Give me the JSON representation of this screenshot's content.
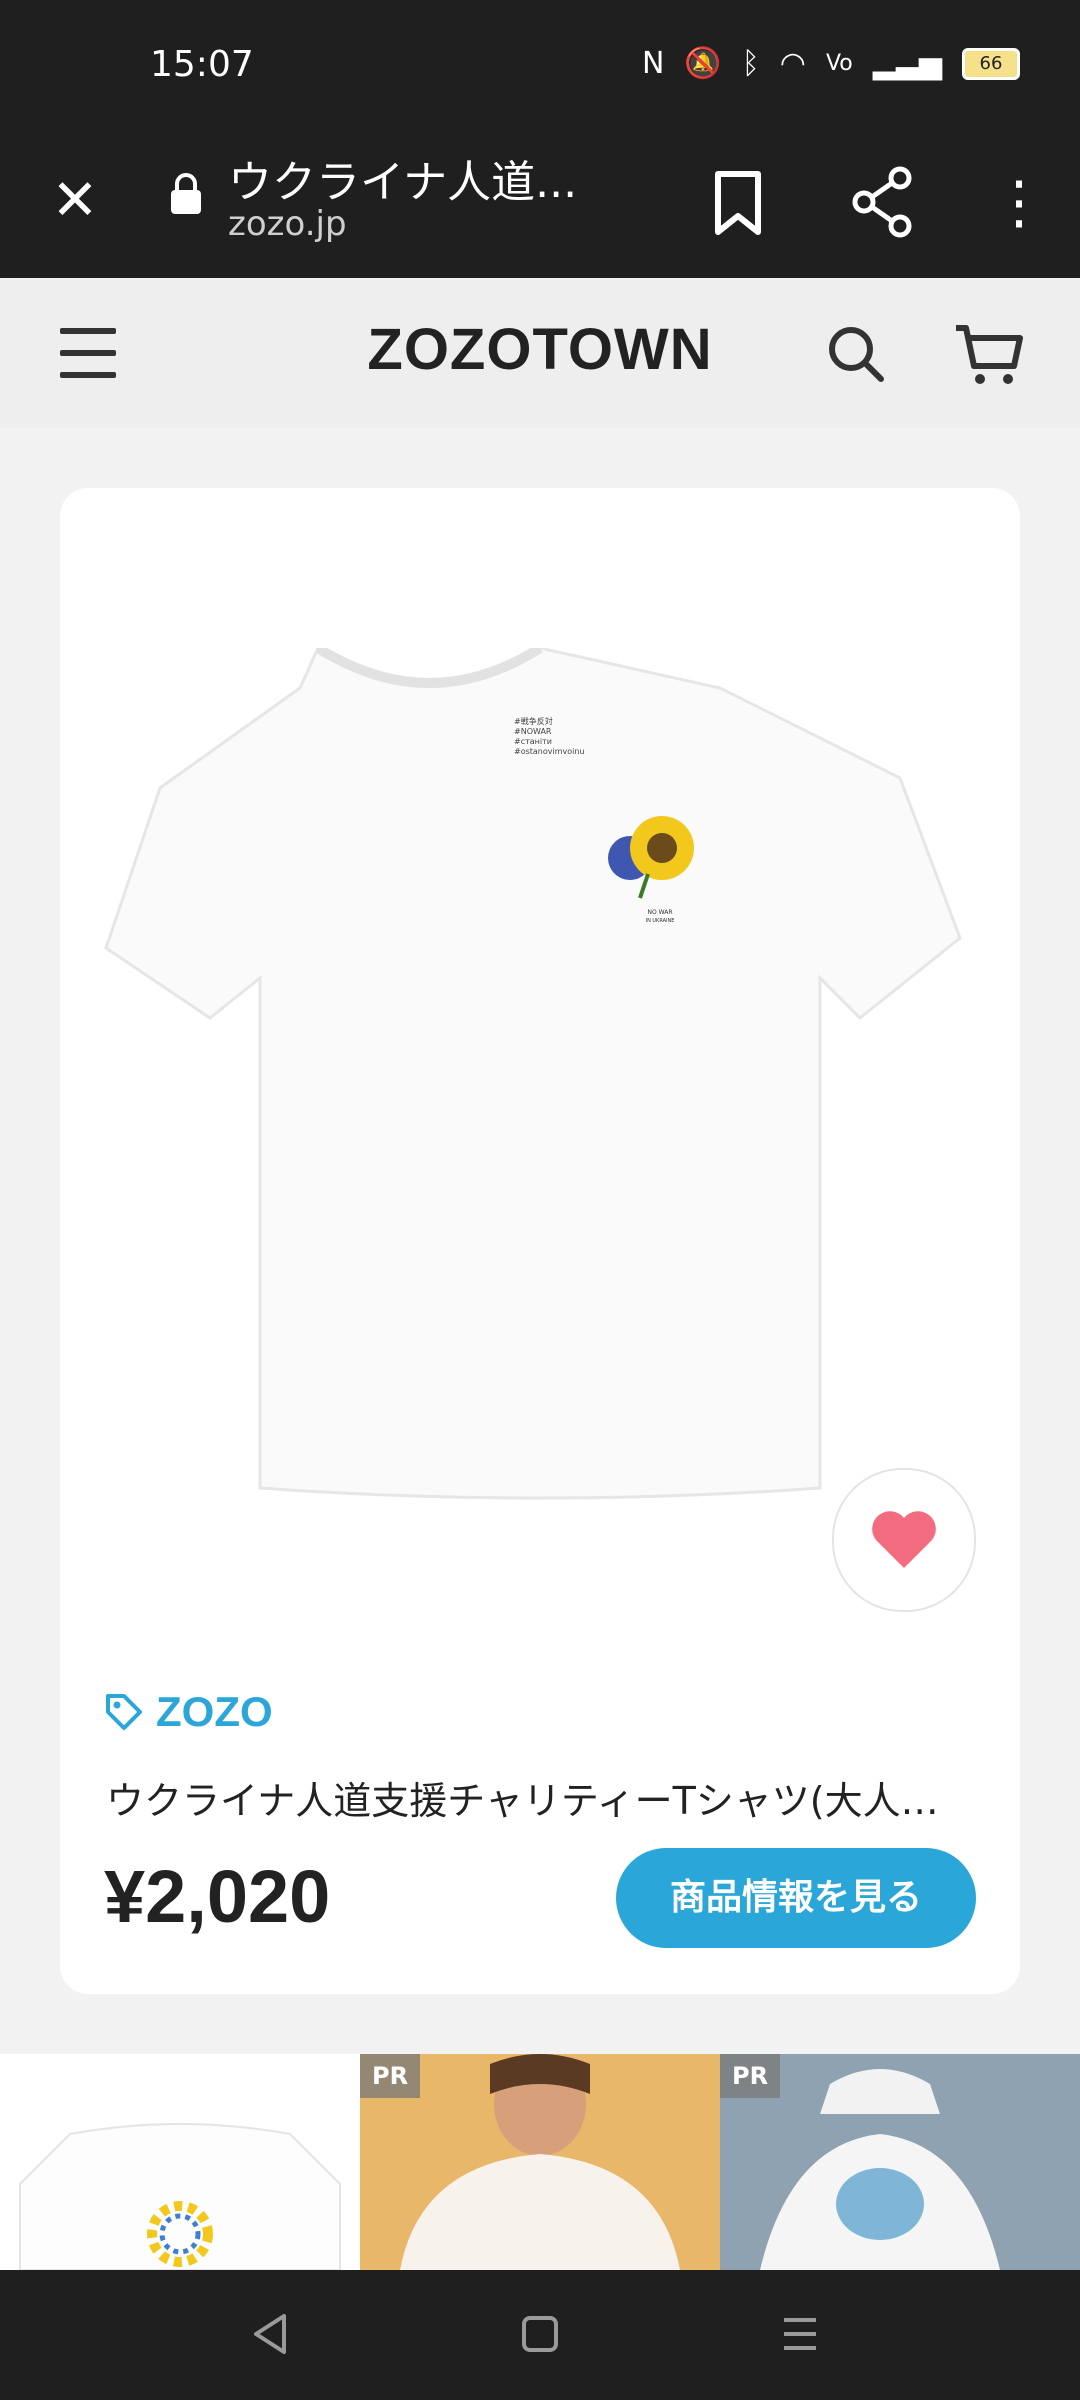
{
  "status_bar": {
    "time": "15:07",
    "battery": "66",
    "icons": [
      "nfc-icon",
      "mute-icon",
      "bluetooth-icon",
      "wifi-icon",
      "volte-icon",
      "signal-icon",
      "battery-icon"
    ]
  },
  "browser": {
    "page_title": "ウクライナ人道...",
    "domain": "zozo.jp"
  },
  "site_header": {
    "logo": "ZOZOTOWN"
  },
  "product": {
    "brand": "ZOZO",
    "title": "ウクライナ人道支援チャリティーTシャツ(大人…",
    "price": "¥2,020",
    "details_button": "商品情報を見る",
    "shirt_print": [
      "#戦争反対",
      "#NOWAR",
      "#станіти",
      "#ostanovimvoinu"
    ],
    "shirt_caption_1": "NO WAR",
    "shirt_caption_2": "IN UKRAINE"
  },
  "thumbnails": [
    {
      "badge": ""
    },
    {
      "badge": "PR"
    },
    {
      "badge": "PR"
    }
  ],
  "colors": {
    "accent": "#2aa6d8",
    "favorite": "#f36b7f"
  }
}
